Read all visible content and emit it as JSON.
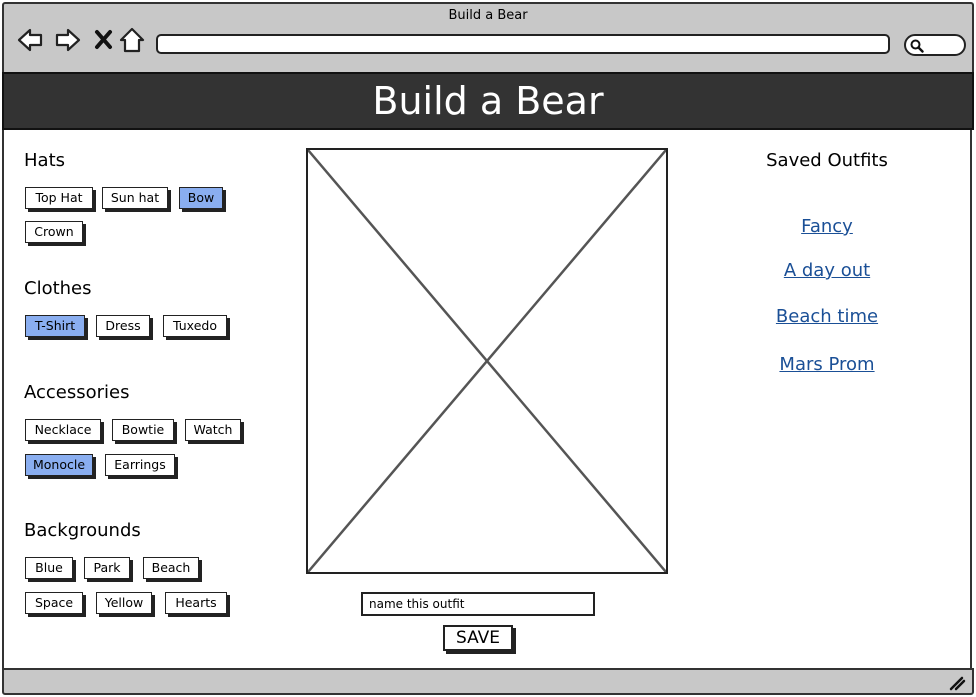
{
  "window": {
    "title": "Build a Bear"
  },
  "browser": {
    "address_value": "",
    "search_value": ""
  },
  "banner": {
    "title": "Build a Bear"
  },
  "sections": {
    "hats": {
      "title": "Hats",
      "items": [
        "Top Hat",
        "Sun hat",
        "Bow",
        "Crown"
      ],
      "selected": "Bow"
    },
    "clothes": {
      "title": "Clothes",
      "items": [
        "T-Shirt",
        "Dress",
        "Tuxedo"
      ],
      "selected": "T-Shirt"
    },
    "accessories": {
      "title": "Accessories",
      "items": [
        "Necklace",
        "Bowtie",
        "Watch",
        "Monocle",
        "Earrings"
      ],
      "selected": "Monocle"
    },
    "backgrounds": {
      "title": "Backgrounds",
      "items": [
        "Blue",
        "Park",
        "Beach",
        "Space",
        "Yellow",
        "Hearts"
      ],
      "selected": null
    }
  },
  "preview": {
    "image": "image-placeholder"
  },
  "outfit_name": {
    "value": "name this outfit",
    "placeholder": ""
  },
  "save_label": "SAVE",
  "saved_outfits": {
    "title": "Saved Outfits",
    "items": [
      "Fancy",
      "A day out",
      "Beach time",
      "Mars Prom"
    ]
  },
  "colors": {
    "selected_chip": "#8aaef0",
    "link": "#1a4f96",
    "banner_bg": "#333333",
    "chrome_bg": "#c8c8c8"
  }
}
